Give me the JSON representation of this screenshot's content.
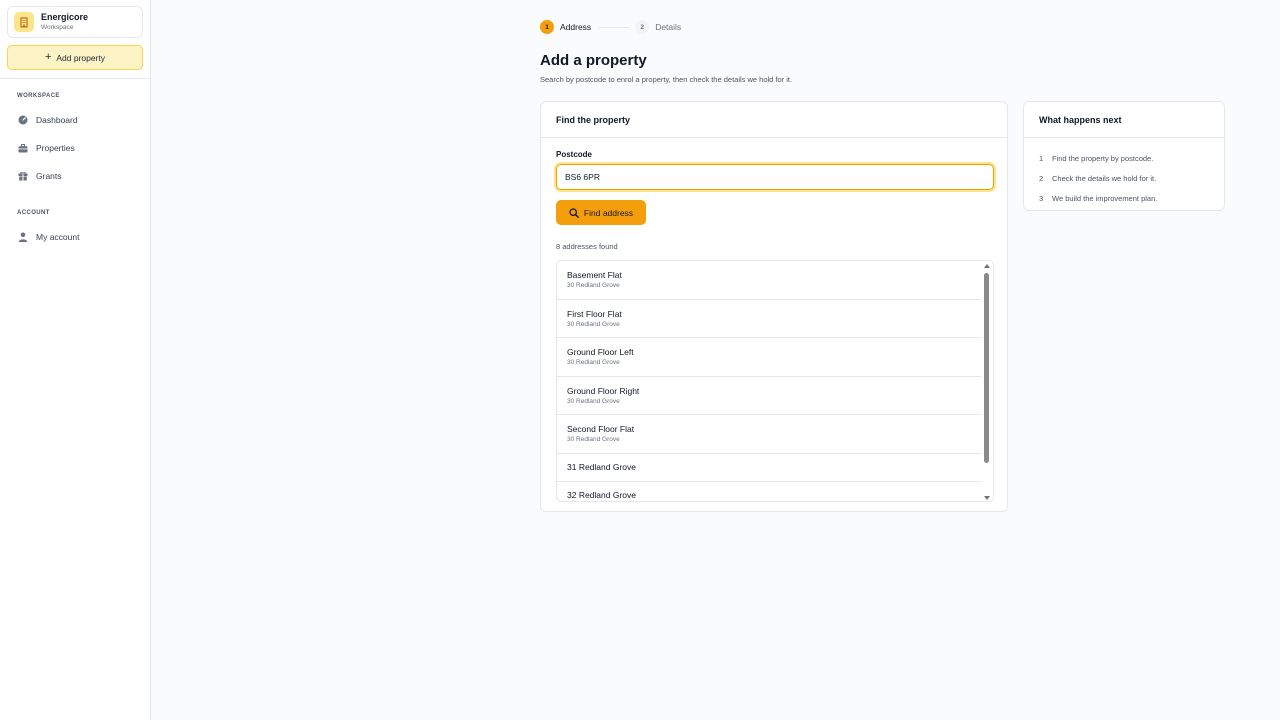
{
  "workspace": {
    "name": "Energicore",
    "subtitle": "Workspace"
  },
  "sidebar": {
    "add_label": "Add property",
    "sections": [
      {
        "title": "WORKSPACE",
        "items": [
          {
            "label": "Dashboard",
            "icon": "gauge-icon"
          },
          {
            "label": "Properties",
            "icon": "briefcase-icon"
          },
          {
            "label": "Grants",
            "icon": "gift-icon"
          }
        ]
      },
      {
        "title": "ACCOUNT",
        "items": [
          {
            "label": "My account",
            "icon": "user-icon"
          }
        ]
      }
    ]
  },
  "stepper": {
    "steps": [
      {
        "num": "1",
        "label": "Address",
        "active": true
      },
      {
        "num": "2",
        "label": "Details",
        "active": false
      }
    ]
  },
  "page": {
    "title": "Add a property",
    "subtitle": "Search by postcode to enrol a property, then check the details we hold for it."
  },
  "find": {
    "header": "Find the property",
    "postcode_label": "Postcode",
    "postcode_value": "BS6 6PR",
    "button_label": "Find address",
    "results_count": "8 addresses found",
    "results": [
      {
        "title": "Basement Flat",
        "sub": "30 Redland Grove"
      },
      {
        "title": "First Floor Flat",
        "sub": "30 Redland Grove"
      },
      {
        "title": "Ground Floor Left",
        "sub": "30 Redland Grove"
      },
      {
        "title": "Ground Floor Right",
        "sub": "30 Redland Grove"
      },
      {
        "title": "Second Floor Flat",
        "sub": "30 Redland Grove"
      },
      {
        "title": "31 Redland Grove",
        "sub": ""
      },
      {
        "title": "32 Redland Grove",
        "sub": ""
      }
    ]
  },
  "next": {
    "header": "What happens next",
    "items": [
      {
        "num": "1",
        "text": "Find the property by postcode."
      },
      {
        "num": "2",
        "text": "Check the details we hold for it."
      },
      {
        "num": "3",
        "text": "We build the improvement plan."
      }
    ]
  },
  "colors": {
    "accent": "#f59e0b",
    "accent_soft": "#fef3c7"
  }
}
